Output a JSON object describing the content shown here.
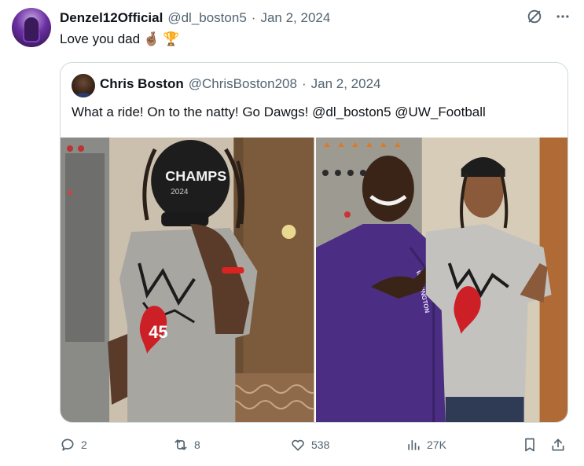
{
  "author": {
    "display_name": "Denzel12Official",
    "handle": "@dl_boston5",
    "separator": "·",
    "date": "Jan 2, 2024"
  },
  "tweet": {
    "text": "Love you dad",
    "emojis": [
      "🤞🏽",
      "🏆"
    ]
  },
  "quoted": {
    "display_name": "Chris Boston",
    "handle": "@ChrisBoston208",
    "separator": "·",
    "date": "Jan 2, 2024",
    "text": "What a ride! On to the natty! Go Dawgs! @dl_boston5 @UW_Football",
    "photo1_hat_text": "CHAMPS",
    "photo1_hat_small": "2024",
    "photo2_jacket_text": "WASHINGTON"
  },
  "metrics": {
    "replies": "2",
    "reposts": "8",
    "likes": "538",
    "views": "27K"
  },
  "icons": {
    "grok": "grok-icon",
    "more": "more-icon",
    "reply": "reply-icon",
    "repost": "repost-icon",
    "like": "like-icon",
    "views": "views-icon",
    "bookmark": "bookmark-icon",
    "share": "share-icon"
  },
  "colors": {
    "text": "#0f1419",
    "muted": "#536471",
    "border": "#cfd9de",
    "husky_purple": "#4b2e83"
  }
}
